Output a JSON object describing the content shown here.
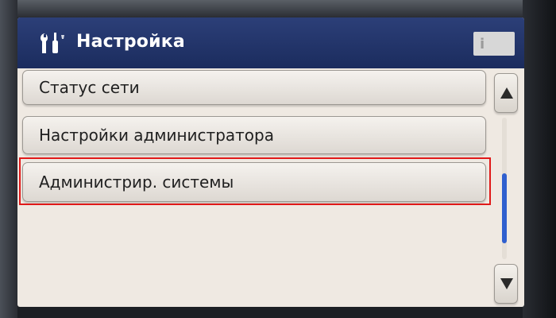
{
  "header": {
    "title": "Настройка",
    "icon": "tools-icon",
    "color": "#1f3366"
  },
  "menu": {
    "items": [
      {
        "label": "Статус сети"
      },
      {
        "label": "Настройки администратора"
      },
      {
        "label": "Администрир. системы",
        "selected": true
      }
    ]
  },
  "info_badge": {
    "label": "i"
  },
  "scroll": {
    "up_icon": "triangle-up-icon",
    "down_icon": "triangle-down-icon",
    "thumb_color": "#2f5fcf",
    "position_fraction": 0.55
  },
  "colors": {
    "screen_bg": "#efe9e2",
    "selection_outline": "#e01919"
  }
}
